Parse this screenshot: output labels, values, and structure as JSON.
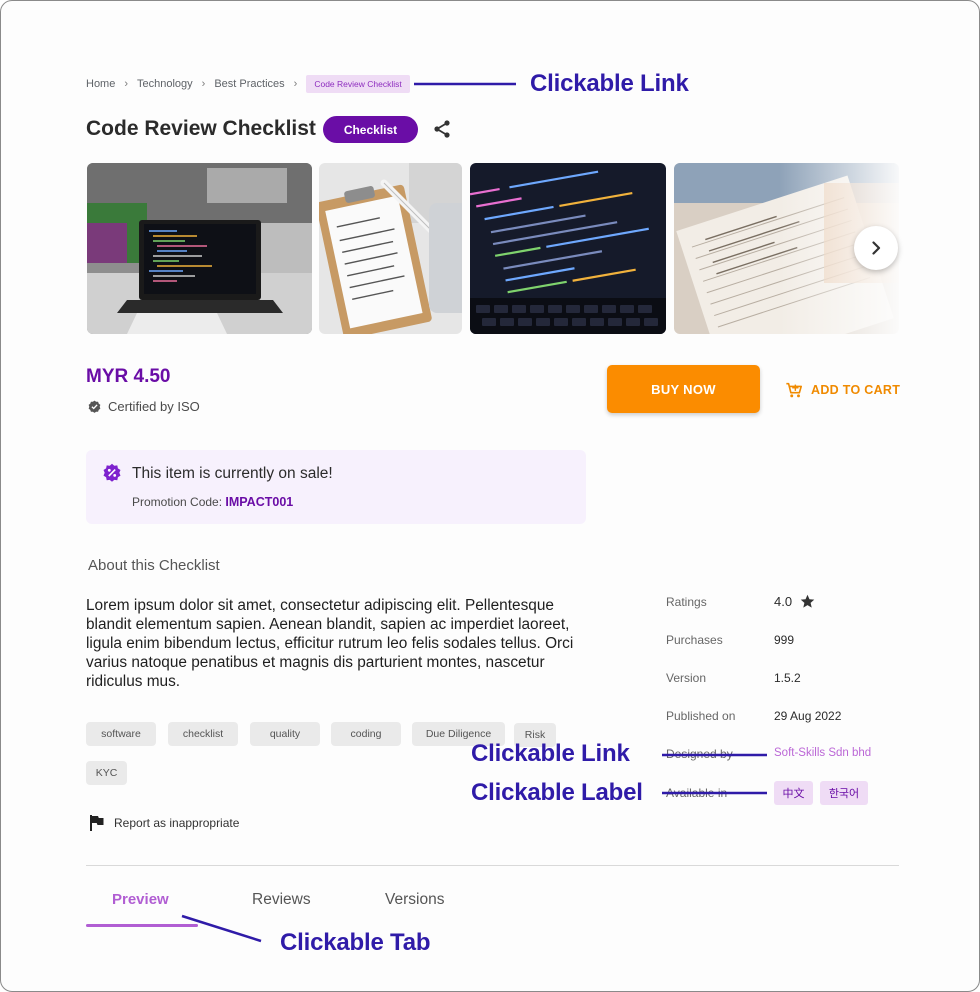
{
  "breadcrumb": {
    "items": [
      "Home",
      "Technology",
      "Best Practices"
    ],
    "separator": "›",
    "current": "Code Review Checklist"
  },
  "product": {
    "title": "Code Review Checklist",
    "type_label": "Checklist",
    "price": "MYR 4.50",
    "certification": "Certified by ISO"
  },
  "actions": {
    "buy_label": "BUY NOW",
    "cart_label": "ADD TO CART"
  },
  "sale": {
    "title": "This item is currently on sale!",
    "code_label": "Promotion Code:",
    "code": "IMPACT001"
  },
  "about": {
    "heading": "About this Checklist",
    "text": "Lorem ipsum dolor sit amet, consectetur adipiscing elit. Pellentesque blandit elementum sapien. Aenean blandit, sapien ac imperdiet laoreet, ligula enim bibendum lectus, efficitur rutrum leo felis sodales tellus. Orci varius natoque penatibus et magnis dis parturient montes, nascetur ridiculus mus."
  },
  "tags": [
    "software",
    "checklist",
    "quality",
    "coding",
    "Due Diligence",
    "Risk",
    "KYC"
  ],
  "report_label": "Report as inappropriate",
  "specs": {
    "ratings_label": "Ratings",
    "ratings_value": "4.0",
    "purchases_label": "Purchases",
    "purchases_value": "999",
    "version_label": "Version",
    "version_value": "1.5.2",
    "published_label": "Published on",
    "published_value": "29 Aug 2022",
    "designer_label": "Designed by",
    "designer_value": "Soft-Skills Sdn bhd",
    "languages_label": "Available in",
    "languages": [
      "中文",
      "한국어"
    ]
  },
  "tabs": [
    "Preview",
    "Reviews",
    "Versions"
  ],
  "annotations": {
    "link_top": "Clickable Link",
    "link_designer": "Clickable Link",
    "label_language": "Clickable Label",
    "tab": "Clickable Tab"
  },
  "colors": {
    "brand_purple": "#6a0da6",
    "accent_orange": "#fb8c00",
    "link_purple": "#bb67d6",
    "annotation_blue": "#2f1ba8"
  }
}
